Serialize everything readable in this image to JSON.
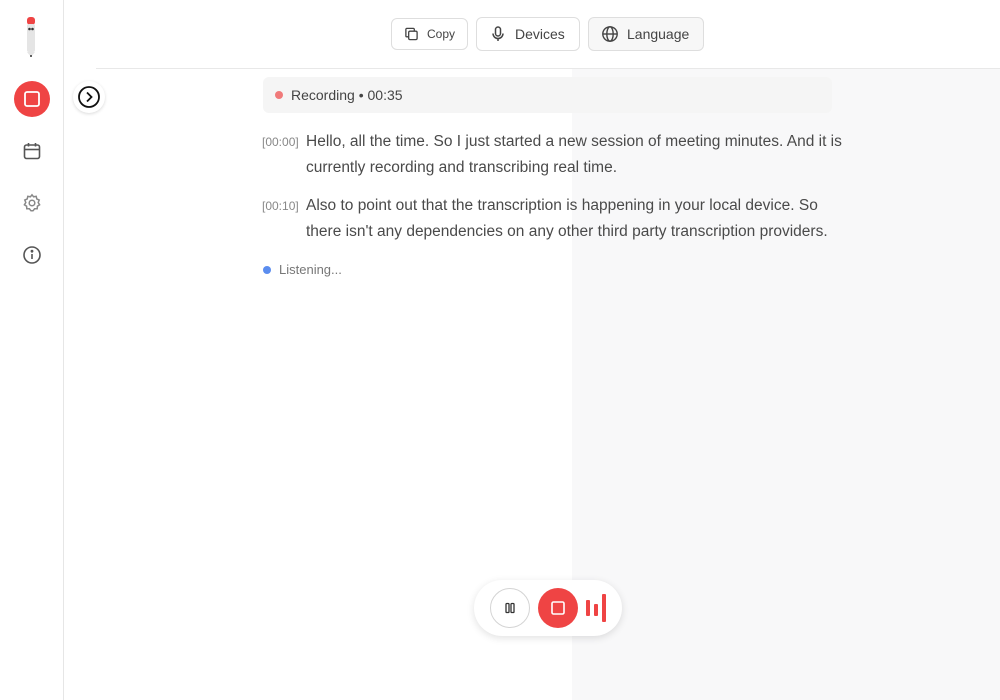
{
  "sidebar": {
    "items": [
      {
        "name": "record",
        "icon": "stop-square-icon",
        "active": true
      },
      {
        "name": "calendar",
        "icon": "calendar-icon"
      },
      {
        "name": "settings",
        "icon": "gear-icon"
      },
      {
        "name": "info",
        "icon": "info-icon"
      }
    ]
  },
  "toolbar": {
    "copy_label": "Copy",
    "devices_label": "Devices",
    "language_label": "Language"
  },
  "recording": {
    "status": "Recording • 00:35"
  },
  "transcript": [
    {
      "time": "[00:00]",
      "text": "Hello, all the time. So I just started a new session of meeting minutes. And it is currently recording and transcribing real time."
    },
    {
      "time": "[00:10]",
      "text": "Also to point out that the transcription is happening in your local device. So there isn't any dependencies on any other third party transcription providers."
    }
  ],
  "listening_label": "Listening...",
  "colors": {
    "accent": "#ef4444",
    "listening": "#5b8def"
  }
}
